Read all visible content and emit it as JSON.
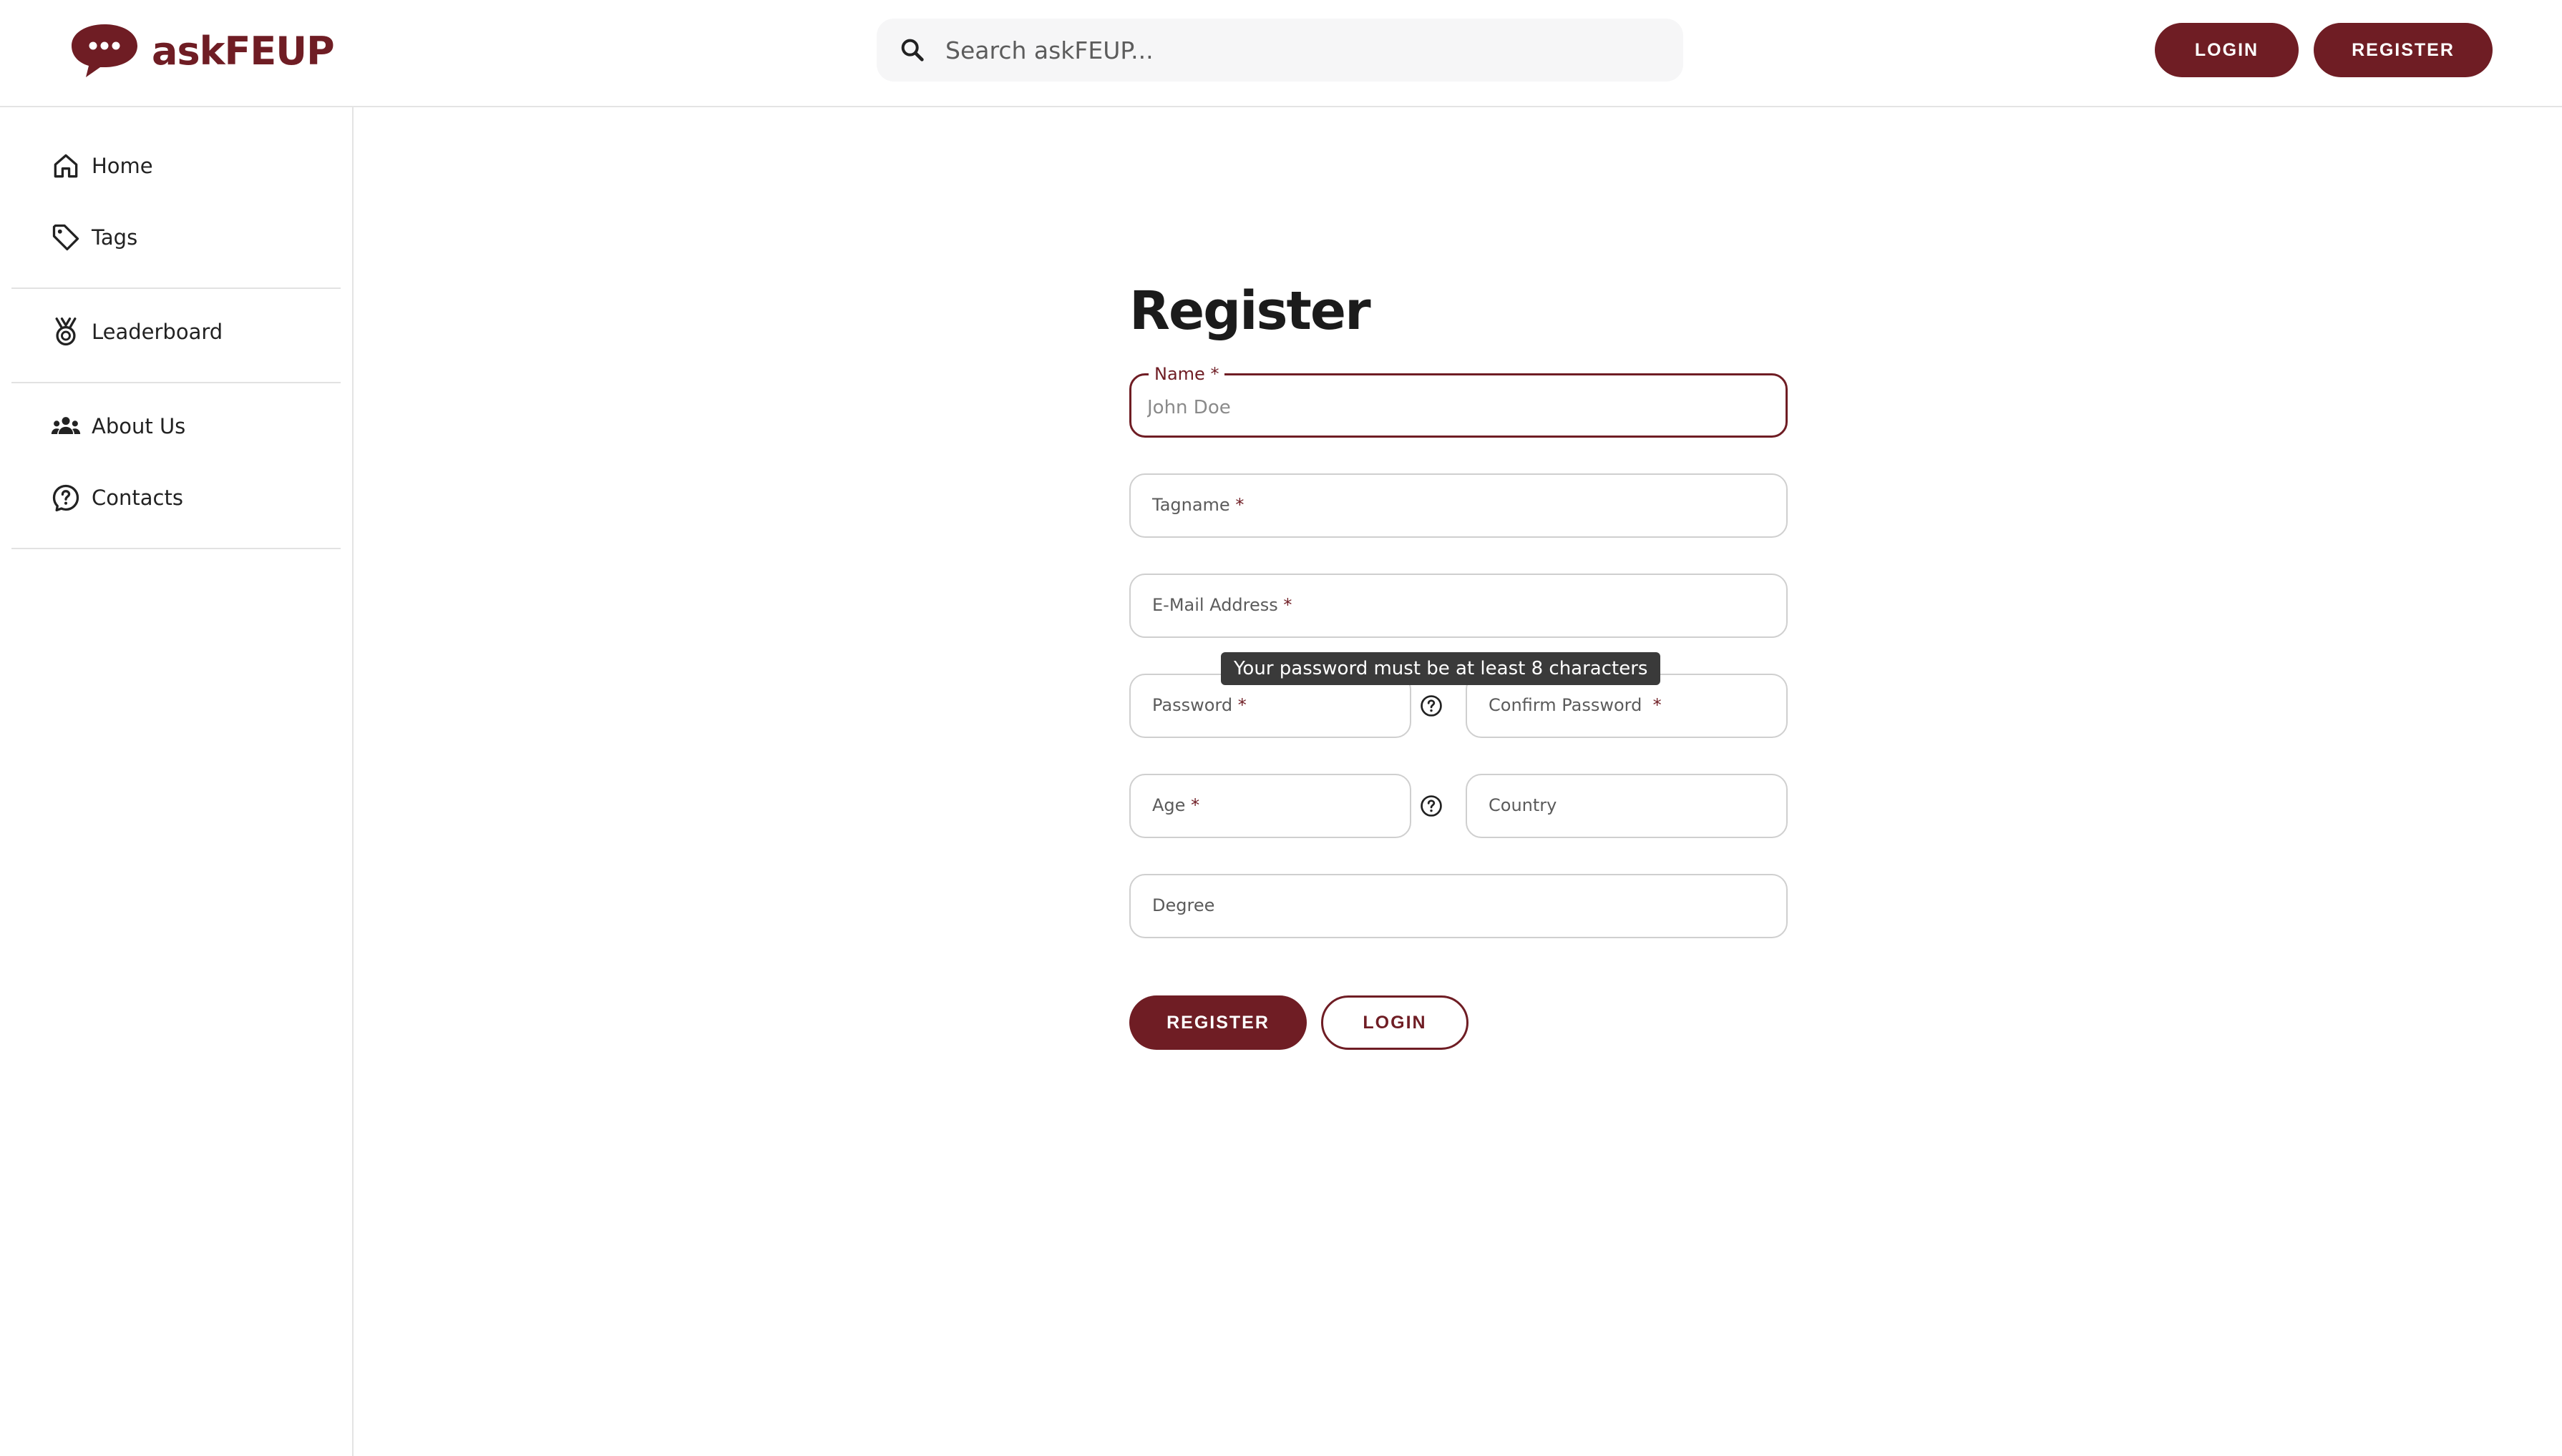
{
  "header": {
    "logo_text": "askFEUP",
    "search_placeholder": "Search askFEUP...",
    "login_label": "LOGIN",
    "register_label": "REGISTER"
  },
  "sidebar": {
    "items": [
      {
        "label": "Home",
        "icon": "home-icon"
      },
      {
        "label": "Tags",
        "icon": "tag-icon"
      },
      {
        "label": "Leaderboard",
        "icon": "medal-icon"
      },
      {
        "label": "About Us",
        "icon": "group-icon"
      },
      {
        "label": "Contacts",
        "icon": "help-circle-icon"
      }
    ]
  },
  "form": {
    "title": "Register",
    "name": {
      "label": "Name",
      "required_mark": "*",
      "placeholder": "John Doe",
      "value": ""
    },
    "tagname": {
      "label": "Tagname",
      "required_mark": "*",
      "value": ""
    },
    "email": {
      "label": "E-Mail Address",
      "required_mark": "*",
      "value": ""
    },
    "password": {
      "label": "Password",
      "required_mark": "*",
      "value": ""
    },
    "confirm_password": {
      "label": "Confirm Password",
      "required_mark": "*",
      "value": ""
    },
    "age": {
      "label": "Age",
      "required_mark": "*",
      "value": ""
    },
    "country": {
      "label": "Country",
      "value": ""
    },
    "degree": {
      "label": "Degree",
      "value": ""
    },
    "password_tooltip": "Your password must be at least 8 characters",
    "register_label": "REGISTER",
    "login_label": "LOGIN"
  },
  "colors": {
    "brand": "#6f1d24",
    "border": "#cfcfcf",
    "tooltip_bg": "#3a3a3a"
  }
}
